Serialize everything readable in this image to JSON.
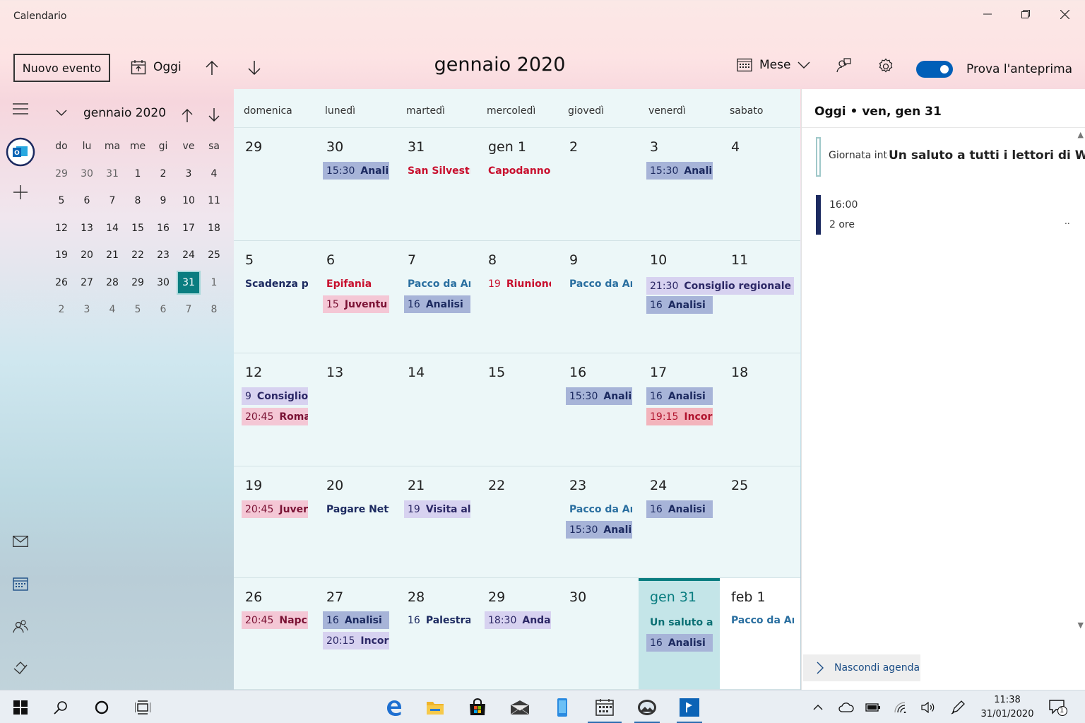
{
  "window": {
    "title": "Calendario"
  },
  "toolbar": {
    "new_event": "Nuovo evento",
    "today": "Oggi",
    "month_title": "gennaio 2020",
    "view": "Mese",
    "preview": "Prova l'anteprima"
  },
  "mini": {
    "title": "gennaio 2020",
    "dow": [
      "do",
      "lu",
      "ma",
      "me",
      "gi",
      "ve",
      "sa"
    ],
    "weeks": [
      [
        "29",
        "30",
        "31",
        "1",
        "2",
        "3",
        "4"
      ],
      [
        "5",
        "6",
        "7",
        "8",
        "9",
        "10",
        "11"
      ],
      [
        "12",
        "13",
        "14",
        "15",
        "16",
        "17",
        "18"
      ],
      [
        "19",
        "20",
        "21",
        "22",
        "23",
        "24",
        "25"
      ],
      [
        "26",
        "27",
        "28",
        "29",
        "30",
        "31",
        "1"
      ],
      [
        "2",
        "3",
        "4",
        "5",
        "6",
        "7",
        "8"
      ]
    ]
  },
  "calendar": {
    "dow": [
      "domenica",
      "lunedì",
      "martedì",
      "mercoledì",
      "giovedì",
      "venerdì",
      "sabato"
    ],
    "weeks": [
      {
        "days": [
          {
            "n": "29",
            "events": []
          },
          {
            "n": "30",
            "events": [
              {
                "t": "15:30",
                "x": "Anali",
                "c": "blue"
              }
            ]
          },
          {
            "n": "31",
            "events": [
              {
                "x": "San Silvestro",
                "c": "t-red"
              }
            ]
          },
          {
            "n": "gen 1",
            "events": [
              {
                "x": "Capodanno",
                "c": "t-red"
              }
            ]
          },
          {
            "n": "2",
            "events": []
          },
          {
            "n": "3",
            "events": [
              {
                "t": "15:30",
                "x": "Anali",
                "c": "blue"
              }
            ]
          },
          {
            "n": "4",
            "events": []
          }
        ]
      },
      {
        "days": [
          {
            "n": "5",
            "events": [
              {
                "x": "Scadenza pr",
                "c": "t-dark"
              }
            ]
          },
          {
            "n": "6",
            "events": [
              {
                "x": "Epifania",
                "c": "t-red"
              },
              {
                "t": "15",
                "x": "Juventu",
                "c": "pink"
              }
            ]
          },
          {
            "n": "7",
            "events": [
              {
                "x": "Pacco da An",
                "c": "t-teal"
              },
              {
                "t": "16",
                "x": "Analisi",
                "c": "blue"
              }
            ]
          },
          {
            "n": "8",
            "events": [
              {
                "t": "19",
                "x": "Riunione",
                "c": "t-redtime"
              }
            ]
          },
          {
            "n": "9",
            "events": [
              {
                "x": "Pacco da An",
                "c": "t-teal"
              }
            ]
          },
          {
            "n": "10",
            "events": [
              {
                "t": "21:30",
                "x": "Consiglio regionale - |",
                "c": "lav",
                "wide": true
              },
              {
                "t": "16",
                "x": "Analisi",
                "c": "blue"
              }
            ]
          },
          {
            "n": "11",
            "events": []
          }
        ]
      },
      {
        "days": [
          {
            "n": "12",
            "events": [
              {
                "t": "9",
                "x": "Consiglio",
                "c": "lav"
              },
              {
                "t": "20:45",
                "x": "Roma",
                "c": "pink"
              }
            ]
          },
          {
            "n": "13",
            "events": []
          },
          {
            "n": "14",
            "events": []
          },
          {
            "n": "15",
            "events": []
          },
          {
            "n": "16",
            "events": [
              {
                "t": "15:30",
                "x": "Analis",
                "c": "blue"
              }
            ]
          },
          {
            "n": "17",
            "events": [
              {
                "t": "16",
                "x": "Analisi",
                "c": "blue"
              },
              {
                "t": "19:15",
                "x": "Incor",
                "c": "red"
              }
            ]
          },
          {
            "n": "18",
            "events": []
          }
        ]
      },
      {
        "days": [
          {
            "n": "19",
            "events": [
              {
                "t": "20:45",
                "x": "Juver",
                "c": "pink"
              }
            ]
          },
          {
            "n": "20",
            "events": [
              {
                "x": "Pagare Netf",
                "c": "t-dark"
              }
            ]
          },
          {
            "n": "21",
            "events": [
              {
                "t": "19",
                "x": "Visita al",
                "c": "lav"
              }
            ]
          },
          {
            "n": "22",
            "events": []
          },
          {
            "n": "23",
            "events": [
              {
                "x": "Pacco da An",
                "c": "t-teal"
              },
              {
                "t": "15:30",
                "x": "Analis",
                "c": "blue"
              }
            ]
          },
          {
            "n": "24",
            "events": [
              {
                "t": "16",
                "x": "Analisi",
                "c": "blue"
              }
            ]
          },
          {
            "n": "25",
            "events": []
          }
        ]
      },
      {
        "days": [
          {
            "n": "26",
            "events": [
              {
                "t": "20:45",
                "x": "Napc",
                "c": "pink"
              }
            ]
          },
          {
            "n": "27",
            "events": [
              {
                "t": "16",
                "x": "Analisi",
                "c": "blue"
              },
              {
                "t": "20:15",
                "x": "Incor",
                "c": "lav"
              }
            ]
          },
          {
            "n": "28",
            "events": [
              {
                "t": "16",
                "x": "Palestra",
                "c": "plain"
              }
            ]
          },
          {
            "n": "29",
            "events": [
              {
                "t": "18:30",
                "x": "Anda",
                "c": "lav"
              }
            ]
          },
          {
            "n": "30",
            "events": []
          },
          {
            "n": "gen 31",
            "today": true,
            "events": [
              {
                "x": "Un saluto a",
                "c": "t-tealdk"
              },
              {
                "t": "16",
                "x": "Analisi",
                "c": "blue"
              }
            ]
          },
          {
            "n": "feb 1",
            "future": true,
            "events": [
              {
                "x": "Pacco da Ar",
                "c": "t-teal"
              }
            ]
          }
        ]
      }
    ]
  },
  "agenda": {
    "header": "Oggi • ven, gen 31",
    "event1": {
      "prefix": "Giornata inte",
      "title": "Un saluto a tutti i lettori di WB..."
    },
    "event2": {
      "time": "16:00",
      "duration": "2 ore",
      "more": ".."
    },
    "hide": "Nascondi agenda"
  },
  "taskbar": {
    "time": "11:38",
    "date": "31/01/2020",
    "badge": "1"
  },
  "colors": {
    "accent": "#0a7d80",
    "toggle": "#005fb8",
    "event_blue": "#a7b4d8",
    "event_pink": "#f4c7d5",
    "event_red": "#f3b4bc",
    "event_lavender": "#d7d2f0"
  }
}
